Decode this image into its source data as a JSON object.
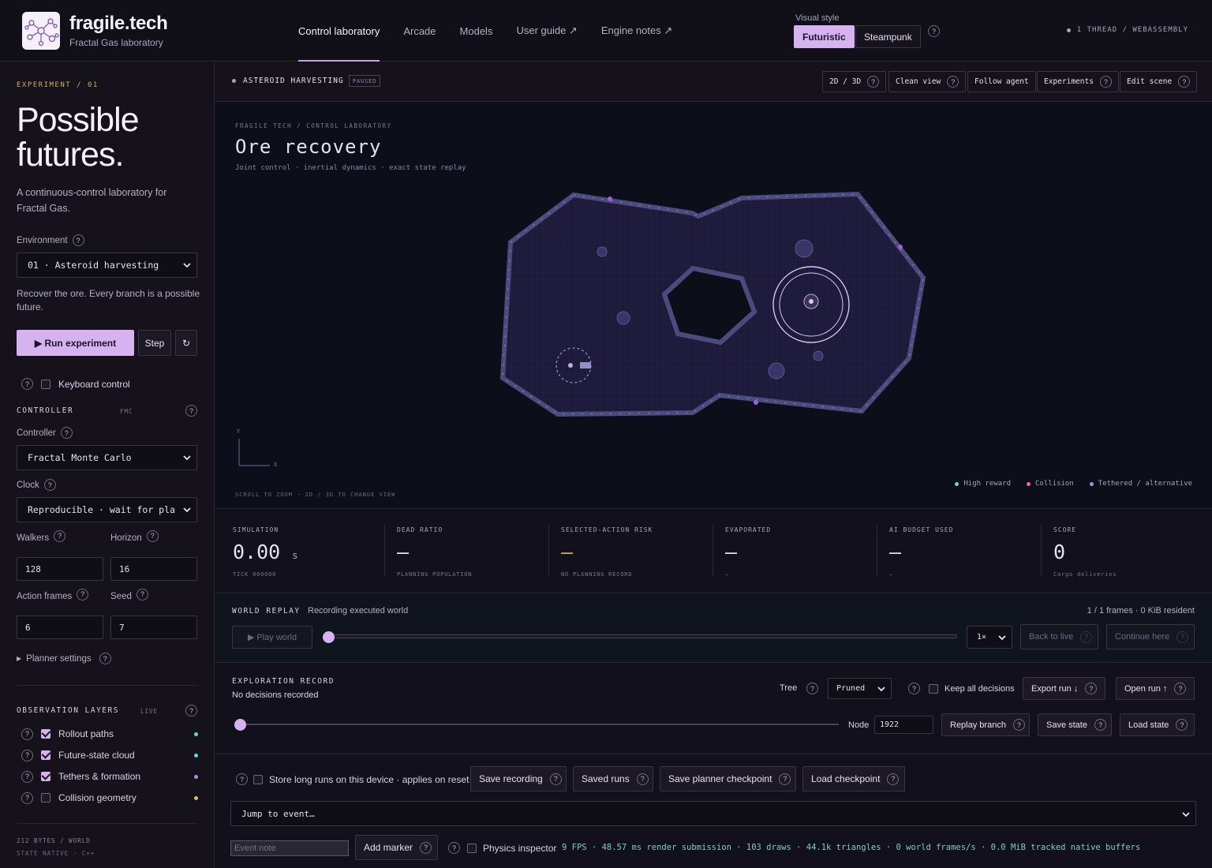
{
  "brand": {
    "name": "fragile.tech",
    "subtitle": "Fractal Gas laboratory"
  },
  "nav": {
    "control": "Control laboratory",
    "arcade": "Arcade",
    "models": "Models",
    "guide": "User guide ↗",
    "engine": "Engine notes ↗"
  },
  "visual_style": {
    "label": "Visual style",
    "futuristic": "Futuristic",
    "steampunk": "Steampunk"
  },
  "thread_info": "1 THREAD / WEBASSEMBLY",
  "sidebar": {
    "experiment_label": "EXPERIMENT / 01",
    "hero": "Possible futures.",
    "hero_sub": "A continuous-control laboratory for Fractal Gas.",
    "environment_label": "Environment",
    "environment_value": "01 · Asteroid harvesting",
    "environment_desc": "Recover the ore. Every branch is a possible future.",
    "run": "▶ Run experiment",
    "step": "Step",
    "reset": "↻",
    "keyboard": "Keyboard control",
    "controller_title": "CONTROLLER",
    "controller_tag": "FMC",
    "controller_label": "Controller",
    "controller_value": "Fractal Monte Carlo",
    "clock_label": "Clock",
    "clock_value": "Reproducible · wait for planner",
    "walkers_label": "Walkers",
    "walkers_value": "128",
    "horizon_label": "Horizon",
    "horizon_value": "16",
    "action_frames_label": "Action frames",
    "action_frames_value": "6",
    "seed_label": "Seed",
    "seed_value": "7",
    "planner": "Planner settings",
    "layers_title": "OBSERVATION LAYERS",
    "layers_tag": "LIVE",
    "layers": [
      {
        "label": "Rollout paths",
        "checked": true,
        "color": "#5fe0b4"
      },
      {
        "label": "Future-state cloud",
        "checked": true,
        "color": "#5fd6e6"
      },
      {
        "label": "Tethers & formation",
        "checked": true,
        "color": "#a58ef0"
      },
      {
        "label": "Collision geometry",
        "checked": false,
        "color": "#e6b85f"
      }
    ],
    "bytes": "212 BYTES / WORLD",
    "native": "STATE NATIVE · C++"
  },
  "status": {
    "scene": "ASTEROID HARVESTING",
    "badge": "PAUSED",
    "btn_2d3d": "2D / 3D",
    "btn_clean": "Clean view",
    "btn_follow": "Follow agent",
    "btn_experiments": "Experiments",
    "btn_edit": "Edit scene"
  },
  "viewport": {
    "crumb": "FRAGILE TECH / CONTROL LABORATORY",
    "title": "Ore recovery",
    "subtitle": "Joint control · inertial dynamics · exact state replay",
    "axis_y": "Y",
    "axis_x": "X",
    "hint": "SCROLL TO ZOOM · 2D / 3D TO CHANGE VIEW",
    "legend": [
      {
        "label": "High reward",
        "color": "#5fe0b4"
      },
      {
        "label": "Collision",
        "color": "#f06a8e"
      },
      {
        "label": "Tethered / alternative",
        "color": "#a58ef0"
      }
    ]
  },
  "metrics": [
    {
      "label": "SIMULATION",
      "value": "0.00",
      "unit": "s",
      "sub": "TICK 000000",
      "color": "#e6e1f0"
    },
    {
      "label": "DEAD RATIO",
      "value": "—",
      "unit": "",
      "sub": "PLANNING POPULATION",
      "color": "#e6e1f0"
    },
    {
      "label": "SELECTED-ACTION RISK",
      "value": "—",
      "unit": "",
      "sub": "NO PLANNING RECORD",
      "color": "#e0a95a"
    },
    {
      "label": "EVAPORATED",
      "value": "—",
      "unit": "",
      "sub": "–",
      "color": "#e6e1f0"
    },
    {
      "label": "AI BUDGET USED",
      "value": "—",
      "unit": "",
      "sub": "–",
      "color": "#e6e1f0"
    },
    {
      "label": "SCORE",
      "value": "0",
      "unit": "",
      "sub": "Cargo deliveries",
      "color": "#e6e1f0"
    }
  ],
  "replay": {
    "title": "WORLD REPLAY",
    "status": "Recording executed world",
    "frames": "1 / 1 frames · 0 KiB resident",
    "play": "▶ Play world",
    "speed": "1×",
    "back": "Back to live",
    "continue": "Continue here"
  },
  "exploration": {
    "title": "EXPLORATION RECORD",
    "status": "No decisions recorded",
    "tree_label": "Tree",
    "tree_value": "Pruned",
    "keep": "Keep all decisions",
    "export": "Export run ↓",
    "open": "Open run ↑",
    "node_label": "Node",
    "node_value": "1922",
    "replay_branch": "Replay branch",
    "save_state": "Save state",
    "load_state": "Load state"
  },
  "storage": {
    "store": "Store long runs on this device · applies on reset",
    "save_recording": "Save recording",
    "saved_runs": "Saved runs",
    "save_checkpoint": "Save planner checkpoint",
    "load_checkpoint": "Load checkpoint",
    "jump": "Jump to event…",
    "note_placeholder": "Event note",
    "add_marker": "Add marker",
    "inspector": "Physics inspector",
    "stats": "9 FPS · 48.57 ms render submission · 103 draws · 44.1k triangles · 0 world frames/s · 0.0 MiB tracked native buffers"
  }
}
